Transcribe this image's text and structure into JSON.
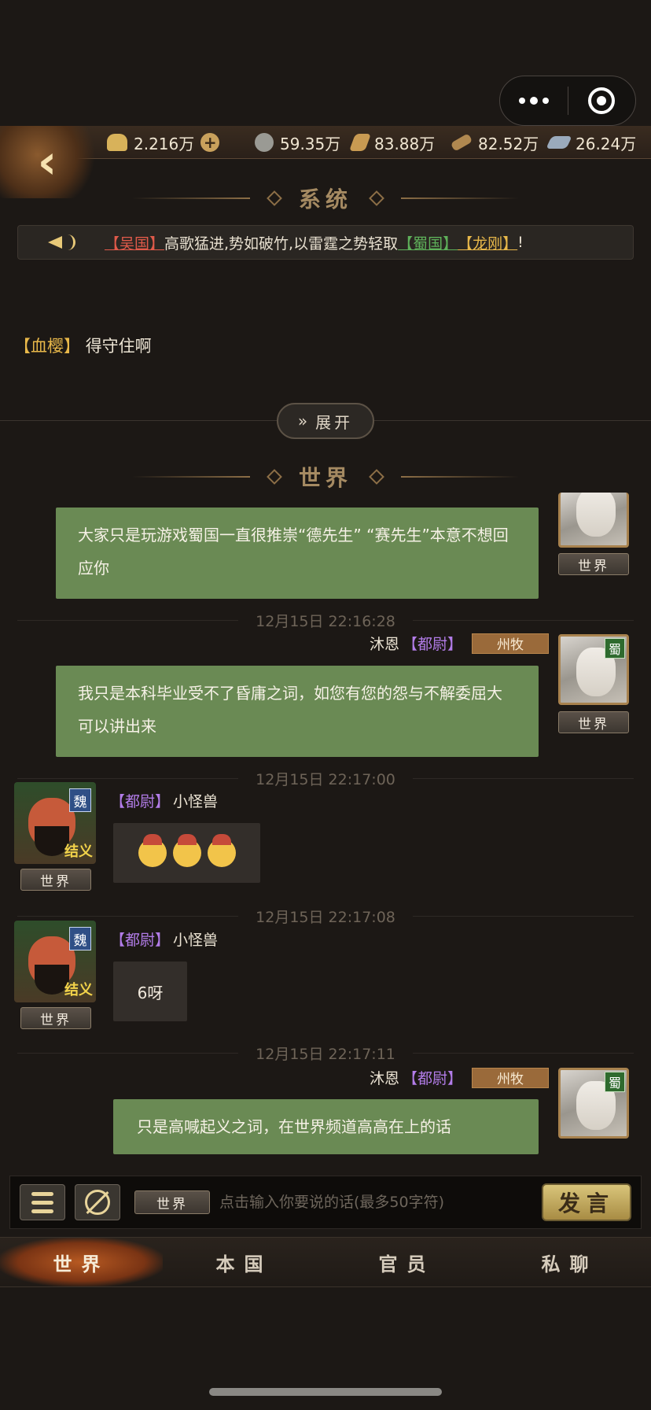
{
  "resources": [
    {
      "value": "2.216万",
      "icon": "ingot-icon",
      "color": "#d8b25a"
    },
    {
      "value": "59.35万",
      "icon": "coin-icon",
      "color": "#9a9a94"
    },
    {
      "value": "83.88万",
      "icon": "grain-icon",
      "color": "#c89a52"
    },
    {
      "value": "82.52万",
      "icon": "wood-icon",
      "color": "#b08850"
    },
    {
      "value": "26.24万",
      "icon": "iron-icon",
      "color": "#9aaabc"
    }
  ],
  "sections": {
    "system": "系统",
    "world": "世界"
  },
  "notice": {
    "tag1": "【吴国】",
    "text1": "高歌猛进,势如破竹,以雷霆之势轻取",
    "tag2": "【蜀国】",
    "tag3": "【龙刚】",
    "end": "!"
  },
  "system_message": {
    "tag": "【血樱】",
    "text": "得守住啊"
  },
  "expand_label": "展开",
  "messages": [
    {
      "text": "大家只是玩游戏蜀国一直很推崇“德先生” “赛先生”本意不想回应你"
    },
    {
      "time": "12月15日 22:16:28",
      "name": "沐恩",
      "title": "【都尉】",
      "rank": "州牧",
      "kingdom": "蜀",
      "text": "我只是本科毕业受不了昏庸之词，如您有您的怨与不解委屈大可以讲出来"
    },
    {
      "time": "12月15日 22:17:00",
      "name": "小怪兽",
      "title": "【都尉】",
      "kingdom": "魏",
      "badge": "结义"
    },
    {
      "time": "12月15日 22:17:08",
      "name": "小怪兽",
      "title": "【都尉】",
      "kingdom": "魏",
      "badge": "结义",
      "text": "6呀"
    },
    {
      "time": "12月15日 22:17:11",
      "name": "沐恩",
      "title": "【都尉】",
      "rank": "州牧",
      "kingdom": "蜀",
      "text": "只是高喊起义之词，在世界频道高高在上的话"
    }
  ],
  "world_tag": "世界",
  "input": {
    "channel": "世界",
    "placeholder": "点击输入你要说的话(最多50字符)",
    "value": "",
    "send": "发言"
  },
  "tabs": [
    "世界",
    "本国",
    "官员",
    "私聊"
  ],
  "active_tab": "世界"
}
